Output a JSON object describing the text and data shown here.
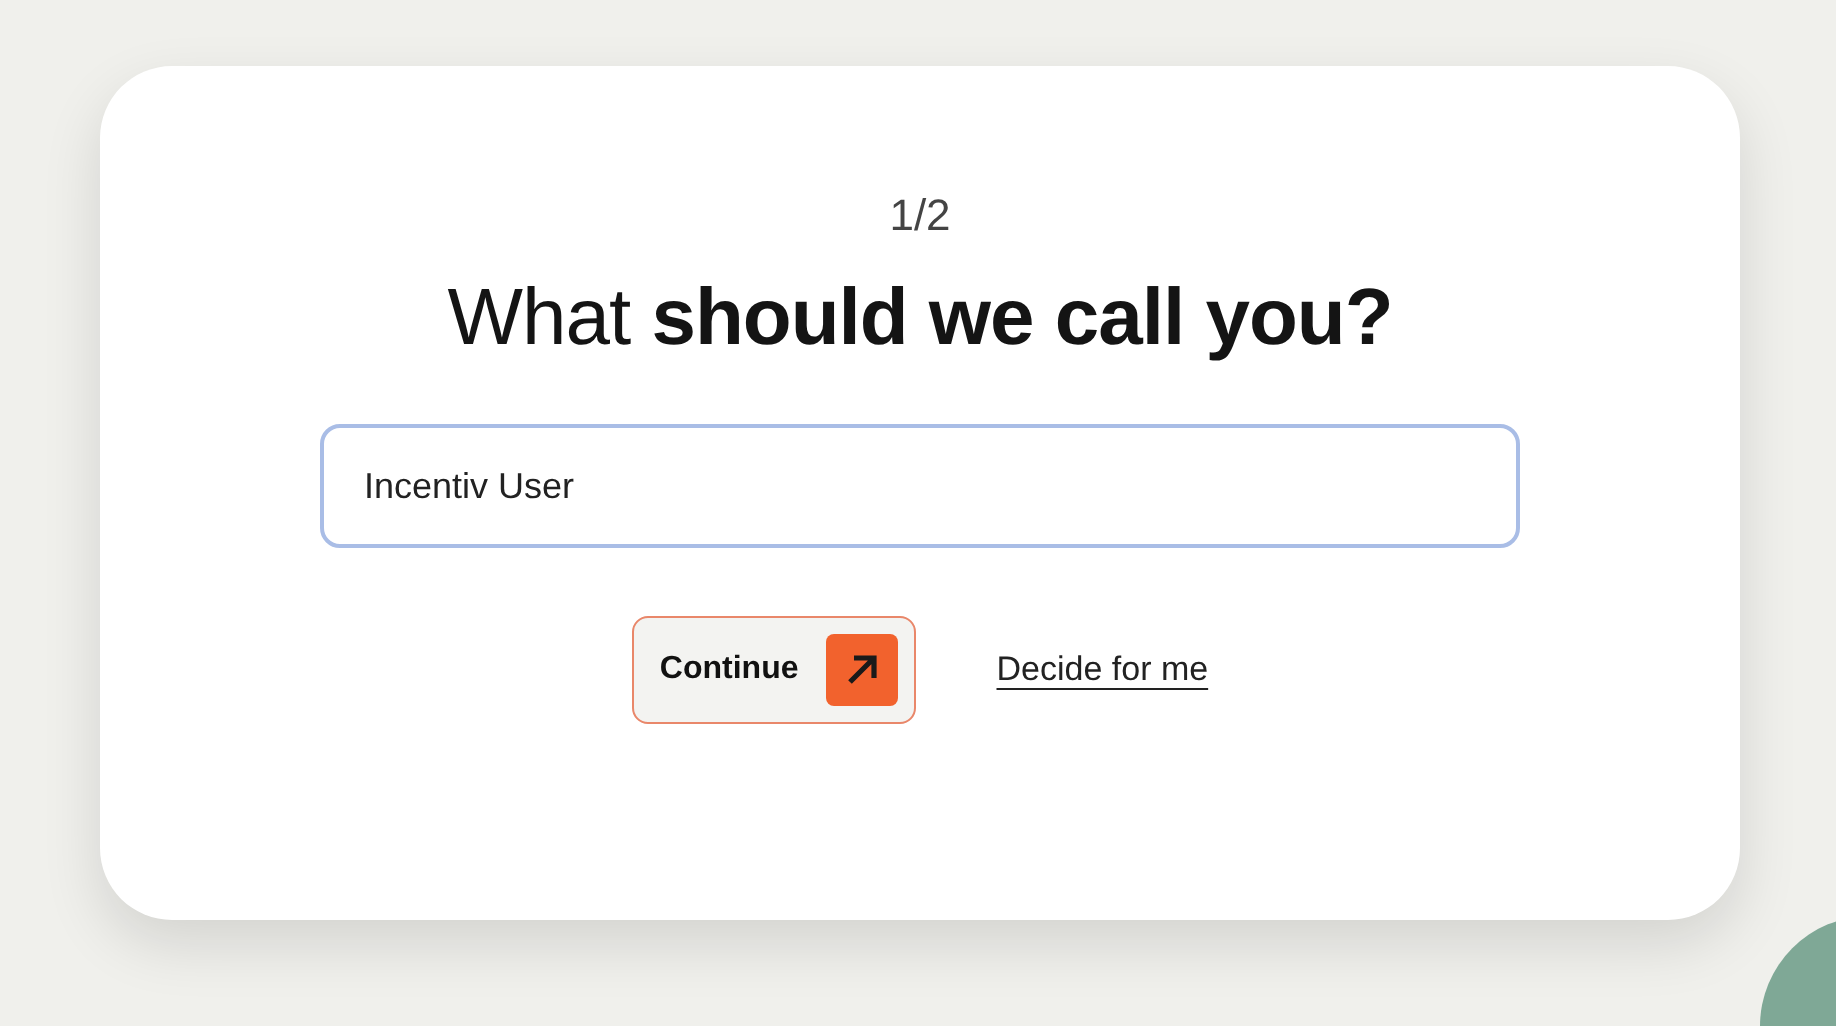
{
  "step": "1/2",
  "heading": "What **should we call you?**",
  "name_field": {
    "value": "Incentiv User"
  },
  "continue_button": {
    "label": "Continue"
  },
  "decide_link": {
    "label": "Decide for me"
  }
}
